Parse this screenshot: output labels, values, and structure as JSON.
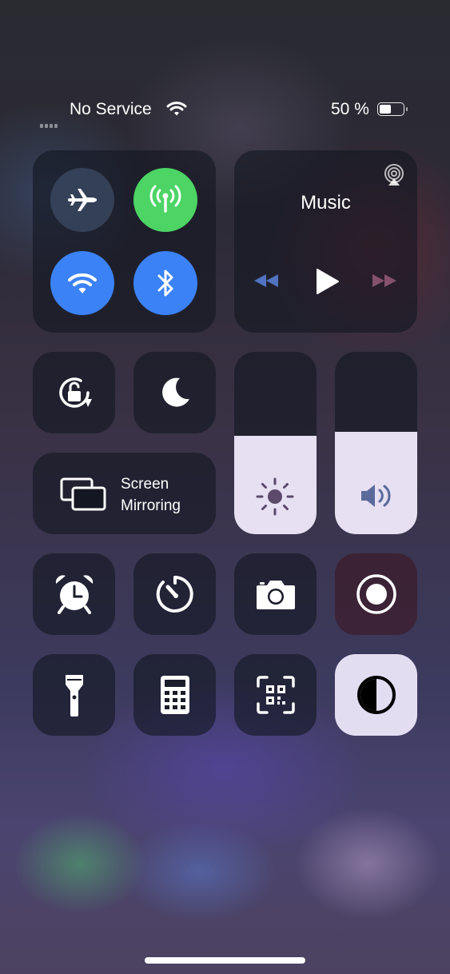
{
  "status_bar": {
    "carrier": "No Service",
    "battery_percent": "50 %",
    "battery_level": 0.5
  },
  "connectivity": {
    "airplane": {
      "icon": "airplane-icon",
      "on": false
    },
    "cellular": {
      "icon": "antenna-icon",
      "on": true,
      "color": "#4cd464"
    },
    "wifi": {
      "icon": "wifi-icon",
      "on": true,
      "color": "#3b82f6"
    },
    "bluetooth": {
      "icon": "bluetooth-icon",
      "on": true,
      "color": "#3b82f6"
    }
  },
  "music": {
    "title": "Music",
    "airplay_icon": "airplay-icon",
    "controls": [
      "rewind-icon",
      "play-icon",
      "fast-forward-icon"
    ]
  },
  "screen_mirroring": {
    "line1": "Screen",
    "line2": "Mirroring",
    "icon": "screen-mirroring-icon"
  },
  "sliders": {
    "brightness": {
      "level": 0.54,
      "icon": "sun-icon"
    },
    "volume": {
      "level": 0.56,
      "icon": "speaker-icon"
    }
  },
  "toggles": {
    "orientation_lock": "rotation-lock-icon",
    "do_not_disturb": "moon-icon"
  },
  "shortcuts": [
    "alarm-clock-icon",
    "timer-icon",
    "camera-icon",
    "screen-record-icon",
    "flashlight-icon",
    "calculator-icon",
    "qr-code-icon",
    "dark-mode-icon"
  ],
  "colors": {
    "accent_blue": "#3b82f6",
    "accent_green": "#4cd464"
  }
}
